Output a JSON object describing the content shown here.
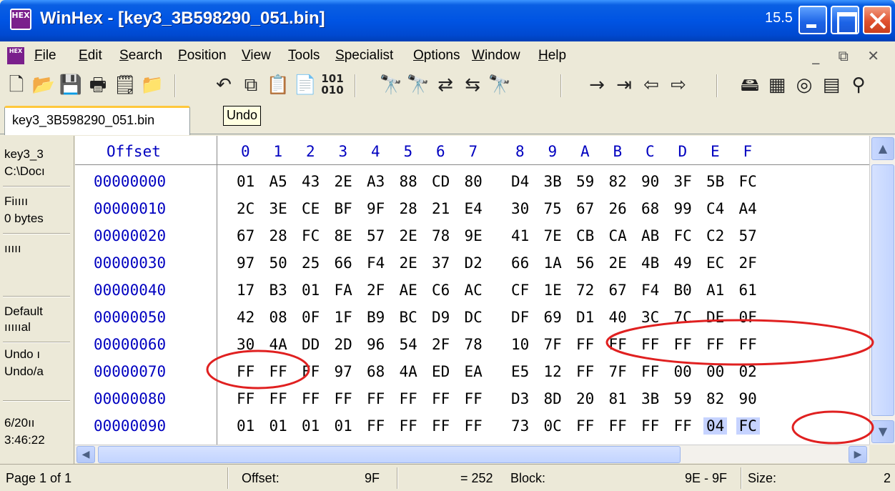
{
  "window": {
    "icon_label": "HEX",
    "title": "WinHex - [key3_3B598290_051.bin]",
    "version": "15.5"
  },
  "menu": {
    "items": [
      {
        "label": "File",
        "underline": "F",
        "rest": "ile"
      },
      {
        "label": "Edit",
        "underline": "E",
        "rest": "dit"
      },
      {
        "label": "Search",
        "underline": "S",
        "rest": "earch"
      },
      {
        "label": "Position",
        "underline": "P",
        "rest": "osition"
      },
      {
        "label": "View",
        "underline": "V",
        "rest": "iew"
      },
      {
        "label": "Tools",
        "underline": "T",
        "rest": "ools"
      },
      {
        "label": "Specialist",
        "underline": "S",
        "rest": "pecialist"
      },
      {
        "label": "Options",
        "underline": "O",
        "rest": "ptions"
      },
      {
        "label": "Window",
        "underline": "W",
        "rest": "indow"
      },
      {
        "label": "Help",
        "underline": "H",
        "rest": "elp"
      }
    ],
    "mdi_controls": "_ ⧉ ✕"
  },
  "toolbar": {
    "icons": [
      "new-file-icon",
      "open-file-icon",
      "save-icon",
      "print-icon",
      "properties-icon",
      "open-disk-icon",
      "undo-icon",
      "copy-icon",
      "paste-icon",
      "paste-write-icon",
      "binary-edit-icon",
      "find-text-icon",
      "find-hex-icon",
      "replace-text-icon",
      "replace-hex-icon",
      "find-again-icon",
      "goto-offset-icon",
      "goto-sector-icon",
      "back-icon",
      "forward-icon",
      "open-disk2-icon",
      "ram-editor-icon",
      "data-interpreter-icon",
      "calculator-icon",
      "search-icon"
    ]
  },
  "tab": {
    "label": "key3_3B598290_051.bin"
  },
  "tooltip": {
    "label": "Undo"
  },
  "info_pane": {
    "lines": [
      "key3_3",
      "C:\\Docı",
      "Fiıııı",
      "0 bytes",
      "ııııı",
      "Default",
      "ıııııal",
      "Undo ı",
      "Undo/a",
      "6/20ıı",
      "3:46:22"
    ]
  },
  "hex": {
    "offset_header": "Offset",
    "columns": [
      "0",
      "1",
      "2",
      "3",
      "4",
      "5",
      "6",
      "7",
      "8",
      "9",
      "A",
      "B",
      "C",
      "D",
      "E",
      "F"
    ],
    "rows": [
      {
        "offset": "00000000",
        "bytes": [
          "01",
          "A5",
          "43",
          "2E",
          "A3",
          "88",
          "CD",
          "80",
          "D4",
          "3B",
          "59",
          "82",
          "90",
          "3F",
          "5B",
          "FC"
        ]
      },
      {
        "offset": "00000010",
        "bytes": [
          "2C",
          "3E",
          "CE",
          "BF",
          "9F",
          "28",
          "21",
          "E4",
          "30",
          "75",
          "67",
          "26",
          "68",
          "99",
          "C4",
          "A4"
        ]
      },
      {
        "offset": "00000020",
        "bytes": [
          "67",
          "28",
          "FC",
          "8E",
          "57",
          "2E",
          "78",
          "9E",
          "41",
          "7E",
          "CB",
          "CA",
          "AB",
          "FC",
          "C2",
          "57"
        ]
      },
      {
        "offset": "00000030",
        "bytes": [
          "97",
          "50",
          "25",
          "66",
          "F4",
          "2E",
          "37",
          "D2",
          "66",
          "1A",
          "56",
          "2E",
          "4B",
          "49",
          "EC",
          "2F"
        ]
      },
      {
        "offset": "00000040",
        "bytes": [
          "17",
          "B3",
          "01",
          "FA",
          "2F",
          "AE",
          "C6",
          "AC",
          "CF",
          "1E",
          "72",
          "67",
          "F4",
          "B0",
          "A1",
          "61"
        ]
      },
      {
        "offset": "00000050",
        "bytes": [
          "42",
          "08",
          "0F",
          "1F",
          "B9",
          "BC",
          "D9",
          "DC",
          "DF",
          "69",
          "D1",
          "40",
          "3C",
          "7C",
          "DE",
          "0F"
        ]
      },
      {
        "offset": "00000060",
        "bytes": [
          "30",
          "4A",
          "DD",
          "2D",
          "96",
          "54",
          "2F",
          "78",
          "10",
          "7F",
          "FF",
          "FF",
          "FF",
          "FF",
          "FF",
          "FF"
        ]
      },
      {
        "offset": "00000070",
        "bytes": [
          "FF",
          "FF",
          "FF",
          "97",
          "68",
          "4A",
          "ED",
          "EA",
          "E5",
          "12",
          "FF",
          "7F",
          "FF",
          "00",
          "00",
          "02"
        ]
      },
      {
        "offset": "00000080",
        "bytes": [
          "FF",
          "FF",
          "FF",
          "FF",
          "FF",
          "FF",
          "FF",
          "FF",
          "D3",
          "8D",
          "20",
          "81",
          "3B",
          "59",
          "82",
          "90"
        ]
      },
      {
        "offset": "00000090",
        "bytes": [
          "01",
          "01",
          "01",
          "01",
          "FF",
          "FF",
          "FF",
          "FF",
          "73",
          "0C",
          "FF",
          "FF",
          "FF",
          "FF",
          "04",
          "FC"
        ]
      }
    ],
    "selection": {
      "row": 9,
      "cols": [
        14,
        15
      ]
    }
  },
  "colors": {
    "offset_blue": "#0000C0",
    "annotation_red": "#E02020",
    "selection": "#C6D3FF"
  },
  "status": {
    "page": "Page 1 of 1",
    "offset_label": "Offset:",
    "offset_value": "9F",
    "decimal_value": "= 252",
    "block_label": "Block:",
    "block_value": "9E - 9F",
    "size_label": "Size:",
    "size_value": "2"
  }
}
